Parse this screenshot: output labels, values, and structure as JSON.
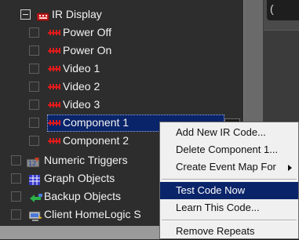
{
  "tree": {
    "root_label": "IR Display",
    "ir_items": [
      {
        "label": "Power Off"
      },
      {
        "label": "Power On"
      },
      {
        "label": "Video 1"
      },
      {
        "label": "Video 2"
      },
      {
        "label": "Video 3"
      },
      {
        "label": "Component 1"
      },
      {
        "label": "Component 2"
      }
    ],
    "groups": [
      {
        "label": "Numeric Triggers",
        "icon": "numeric-triggers-icon"
      },
      {
        "label": "Graph Objects",
        "icon": "graph-objects-icon"
      },
      {
        "label": "Backup Objects",
        "icon": "backup-objects-icon"
      },
      {
        "label": "Client HomeLogic S",
        "icon": "client-homelogic-icon"
      }
    ],
    "selected_item": "Component 1"
  },
  "context_menu": {
    "items": [
      {
        "label": "Add New IR Code..."
      },
      {
        "label": "Delete Component 1..."
      },
      {
        "label": "Create Event Map For"
      },
      {
        "label": "Test Code Now"
      },
      {
        "label": "Learn This Code..."
      },
      {
        "label": "Remove Repeats"
      }
    ],
    "active_item": "Test Code Now"
  },
  "right_panel": {
    "top_text": "("
  },
  "colors": {
    "selection": "#0a246a",
    "ir_red": "#e21b1b",
    "menu_bg": "#f0f0f0"
  }
}
